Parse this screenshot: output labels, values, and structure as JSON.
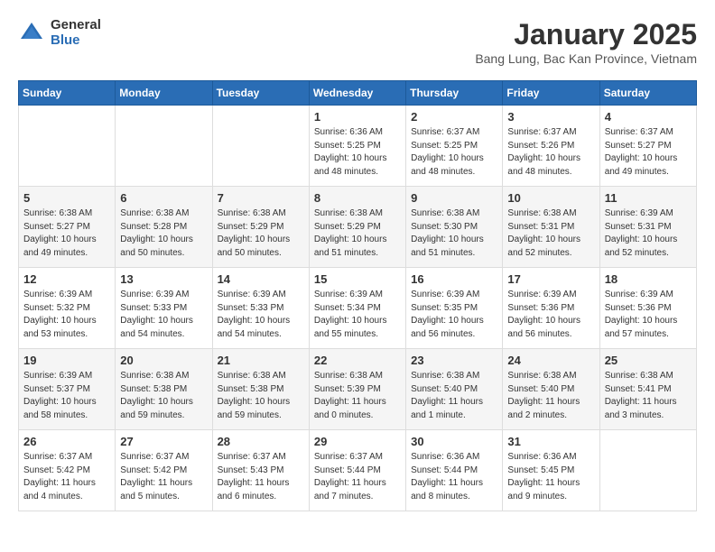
{
  "header": {
    "logo_general": "General",
    "logo_blue": "Blue",
    "title": "January 2025",
    "subtitle": "Bang Lung, Bac Kan Province, Vietnam"
  },
  "columns": [
    "Sunday",
    "Monday",
    "Tuesday",
    "Wednesday",
    "Thursday",
    "Friday",
    "Saturday"
  ],
  "weeks": [
    {
      "days": [
        {
          "num": "",
          "content": "",
          "empty": true
        },
        {
          "num": "",
          "content": "",
          "empty": true
        },
        {
          "num": "",
          "content": "",
          "empty": true
        },
        {
          "num": "1",
          "content": "Sunrise: 6:36 AM\nSunset: 5:25 PM\nDaylight: 10 hours\nand 48 minutes."
        },
        {
          "num": "2",
          "content": "Sunrise: 6:37 AM\nSunset: 5:25 PM\nDaylight: 10 hours\nand 48 minutes."
        },
        {
          "num": "3",
          "content": "Sunrise: 6:37 AM\nSunset: 5:26 PM\nDaylight: 10 hours\nand 48 minutes."
        },
        {
          "num": "4",
          "content": "Sunrise: 6:37 AM\nSunset: 5:27 PM\nDaylight: 10 hours\nand 49 minutes."
        }
      ]
    },
    {
      "days": [
        {
          "num": "5",
          "content": "Sunrise: 6:38 AM\nSunset: 5:27 PM\nDaylight: 10 hours\nand 49 minutes."
        },
        {
          "num": "6",
          "content": "Sunrise: 6:38 AM\nSunset: 5:28 PM\nDaylight: 10 hours\nand 50 minutes."
        },
        {
          "num": "7",
          "content": "Sunrise: 6:38 AM\nSunset: 5:29 PM\nDaylight: 10 hours\nand 50 minutes."
        },
        {
          "num": "8",
          "content": "Sunrise: 6:38 AM\nSunset: 5:29 PM\nDaylight: 10 hours\nand 51 minutes."
        },
        {
          "num": "9",
          "content": "Sunrise: 6:38 AM\nSunset: 5:30 PM\nDaylight: 10 hours\nand 51 minutes."
        },
        {
          "num": "10",
          "content": "Sunrise: 6:38 AM\nSunset: 5:31 PM\nDaylight: 10 hours\nand 52 minutes."
        },
        {
          "num": "11",
          "content": "Sunrise: 6:39 AM\nSunset: 5:31 PM\nDaylight: 10 hours\nand 52 minutes."
        }
      ]
    },
    {
      "days": [
        {
          "num": "12",
          "content": "Sunrise: 6:39 AM\nSunset: 5:32 PM\nDaylight: 10 hours\nand 53 minutes."
        },
        {
          "num": "13",
          "content": "Sunrise: 6:39 AM\nSunset: 5:33 PM\nDaylight: 10 hours\nand 54 minutes."
        },
        {
          "num": "14",
          "content": "Sunrise: 6:39 AM\nSunset: 5:33 PM\nDaylight: 10 hours\nand 54 minutes."
        },
        {
          "num": "15",
          "content": "Sunrise: 6:39 AM\nSunset: 5:34 PM\nDaylight: 10 hours\nand 55 minutes."
        },
        {
          "num": "16",
          "content": "Sunrise: 6:39 AM\nSunset: 5:35 PM\nDaylight: 10 hours\nand 56 minutes."
        },
        {
          "num": "17",
          "content": "Sunrise: 6:39 AM\nSunset: 5:36 PM\nDaylight: 10 hours\nand 56 minutes."
        },
        {
          "num": "18",
          "content": "Sunrise: 6:39 AM\nSunset: 5:36 PM\nDaylight: 10 hours\nand 57 minutes."
        }
      ]
    },
    {
      "days": [
        {
          "num": "19",
          "content": "Sunrise: 6:39 AM\nSunset: 5:37 PM\nDaylight: 10 hours\nand 58 minutes."
        },
        {
          "num": "20",
          "content": "Sunrise: 6:38 AM\nSunset: 5:38 PM\nDaylight: 10 hours\nand 59 minutes."
        },
        {
          "num": "21",
          "content": "Sunrise: 6:38 AM\nSunset: 5:38 PM\nDaylight: 10 hours\nand 59 minutes."
        },
        {
          "num": "22",
          "content": "Sunrise: 6:38 AM\nSunset: 5:39 PM\nDaylight: 11 hours\nand 0 minutes."
        },
        {
          "num": "23",
          "content": "Sunrise: 6:38 AM\nSunset: 5:40 PM\nDaylight: 11 hours\nand 1 minute."
        },
        {
          "num": "24",
          "content": "Sunrise: 6:38 AM\nSunset: 5:40 PM\nDaylight: 11 hours\nand 2 minutes."
        },
        {
          "num": "25",
          "content": "Sunrise: 6:38 AM\nSunset: 5:41 PM\nDaylight: 11 hours\nand 3 minutes."
        }
      ]
    },
    {
      "days": [
        {
          "num": "26",
          "content": "Sunrise: 6:37 AM\nSunset: 5:42 PM\nDaylight: 11 hours\nand 4 minutes."
        },
        {
          "num": "27",
          "content": "Sunrise: 6:37 AM\nSunset: 5:42 PM\nDaylight: 11 hours\nand 5 minutes."
        },
        {
          "num": "28",
          "content": "Sunrise: 6:37 AM\nSunset: 5:43 PM\nDaylight: 11 hours\nand 6 minutes."
        },
        {
          "num": "29",
          "content": "Sunrise: 6:37 AM\nSunset: 5:44 PM\nDaylight: 11 hours\nand 7 minutes."
        },
        {
          "num": "30",
          "content": "Sunrise: 6:36 AM\nSunset: 5:44 PM\nDaylight: 11 hours\nand 8 minutes."
        },
        {
          "num": "31",
          "content": "Sunrise: 6:36 AM\nSunset: 5:45 PM\nDaylight: 11 hours\nand 9 minutes."
        },
        {
          "num": "",
          "content": "",
          "empty": true
        }
      ]
    }
  ]
}
